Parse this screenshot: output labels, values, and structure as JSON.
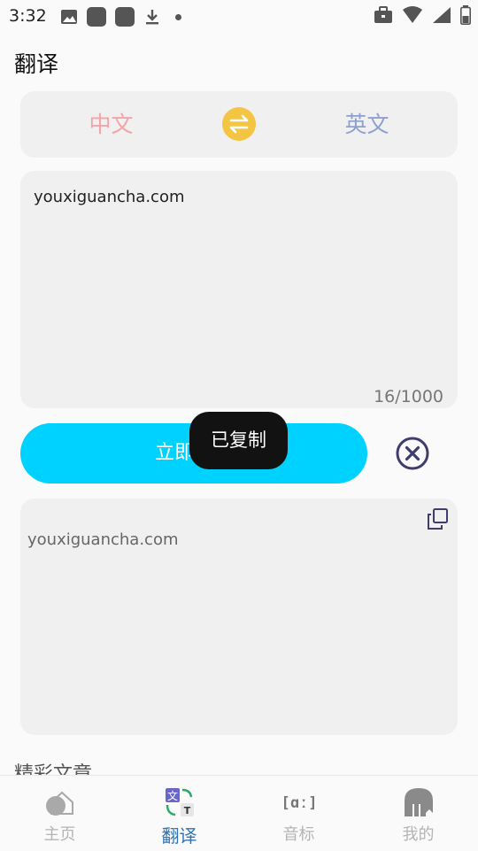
{
  "status_bar": {
    "time": "3:32"
  },
  "header": {
    "title": "翻译"
  },
  "language_switch": {
    "source": "中文",
    "target": "英文"
  },
  "input": {
    "text": "youxiguancha.com",
    "char_count": "16/1000"
  },
  "translate_button": {
    "label": "立即翻译"
  },
  "toast": {
    "text": "已复制"
  },
  "output": {
    "text": "youxiguancha.com"
  },
  "section": {
    "title": "精彩文章"
  },
  "bottom_nav": {
    "items": [
      {
        "label": "主页",
        "icon": "home-icon",
        "active": false
      },
      {
        "label": "翻译",
        "icon": "translate-icon",
        "active": true
      },
      {
        "label": "音标",
        "icon": "phonetic-icon",
        "active": false
      },
      {
        "label": "我的",
        "icon": "profile-icon",
        "active": false
      }
    ]
  },
  "colors": {
    "accent": "#00d2ff",
    "source_lang": "#f4a3a8",
    "target_lang": "#8ea0cf",
    "swap": "#f4c542",
    "nav_active": "#2e74b5"
  }
}
